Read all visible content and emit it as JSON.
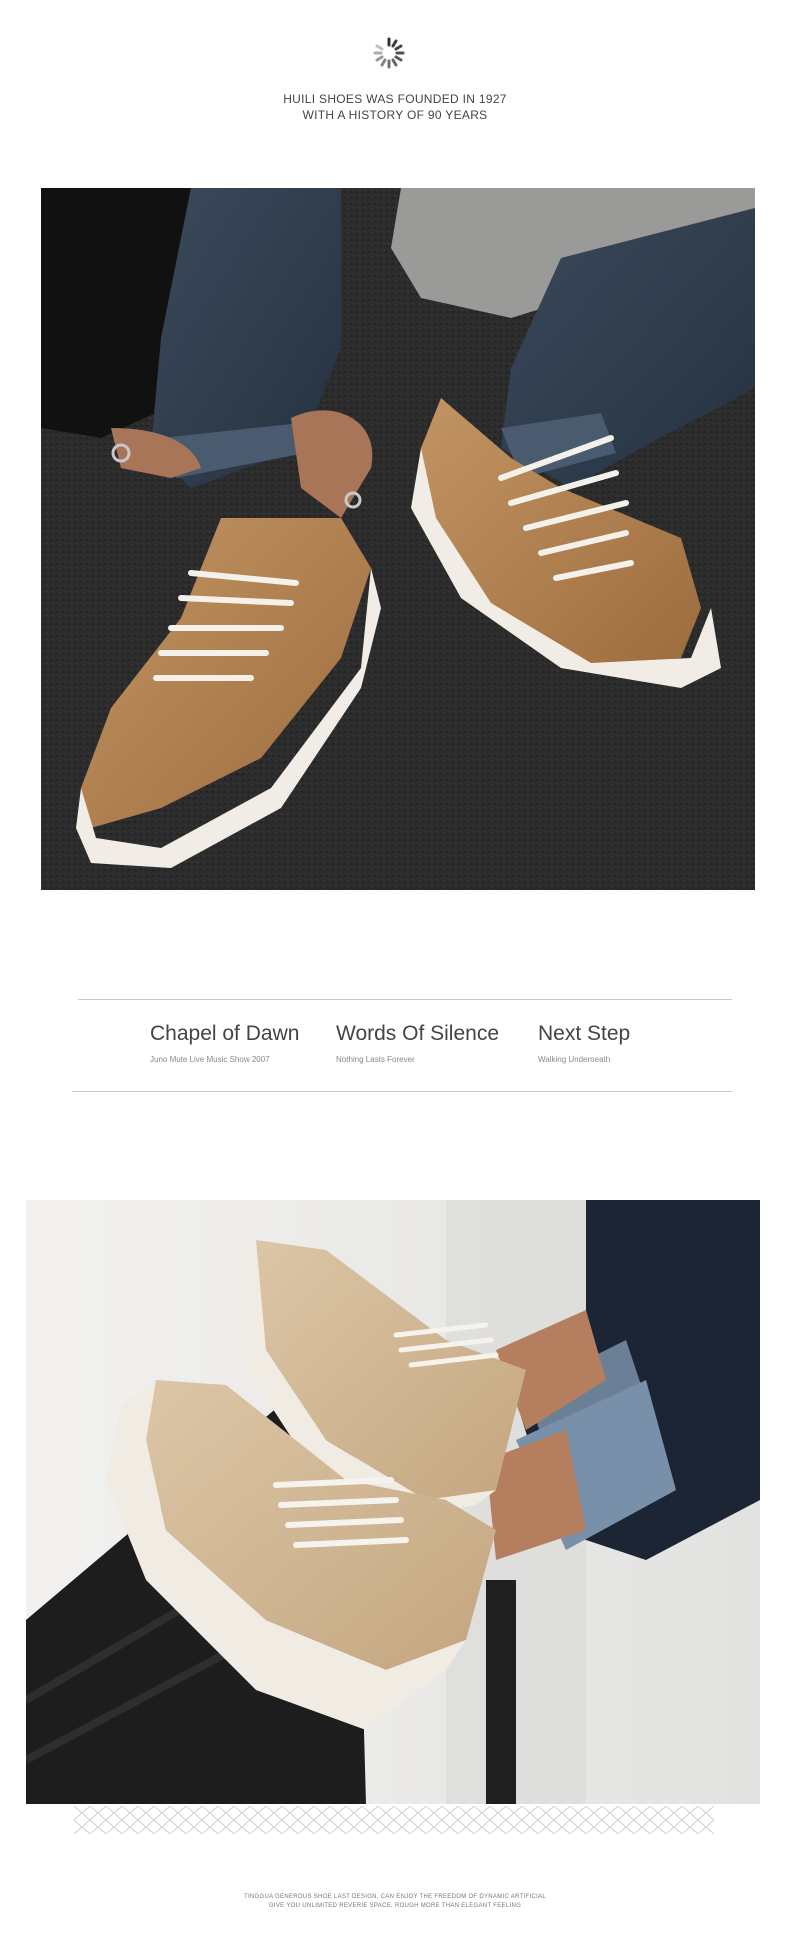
{
  "header": {
    "loader_icon": "loading-spinner-icon",
    "brand_line_1": "HUILI SHOES WAS FOUNDED IN 1927",
    "brand_line_2": "WITH A HISTORY OF 90 YEARS"
  },
  "photos": [
    {
      "name": "tan-suede-sneakers-on-asphalt"
    },
    {
      "name": "beige-sneakers-on-bench"
    }
  ],
  "band": {
    "items": [
      {
        "title": "Chapel of Dawn",
        "subtitle": "Juno Mute Live Music Show 2007"
      },
      {
        "title": "Words Of Silence",
        "subtitle": "Nothing Lasts Forever"
      },
      {
        "title": "Next Step",
        "subtitle": "Walking Underneath"
      }
    ]
  },
  "footer": {
    "line_1": "TINGGUA GENEROUS SHOE LAST DESIGN, CAN ENJOY THE FREEDOM OF DYNAMIC ARTIFICIAL",
    "line_2": "GIVE YOU UNLIMITED REVERIE SPACE, ROUGH MORE THAN ELEGANT FEELING"
  },
  "colors": {
    "suede_tan": "#b08152",
    "suede_beige": "#d2b896",
    "asphalt": "#2c2c2c",
    "rule": "#c9c9c9"
  }
}
